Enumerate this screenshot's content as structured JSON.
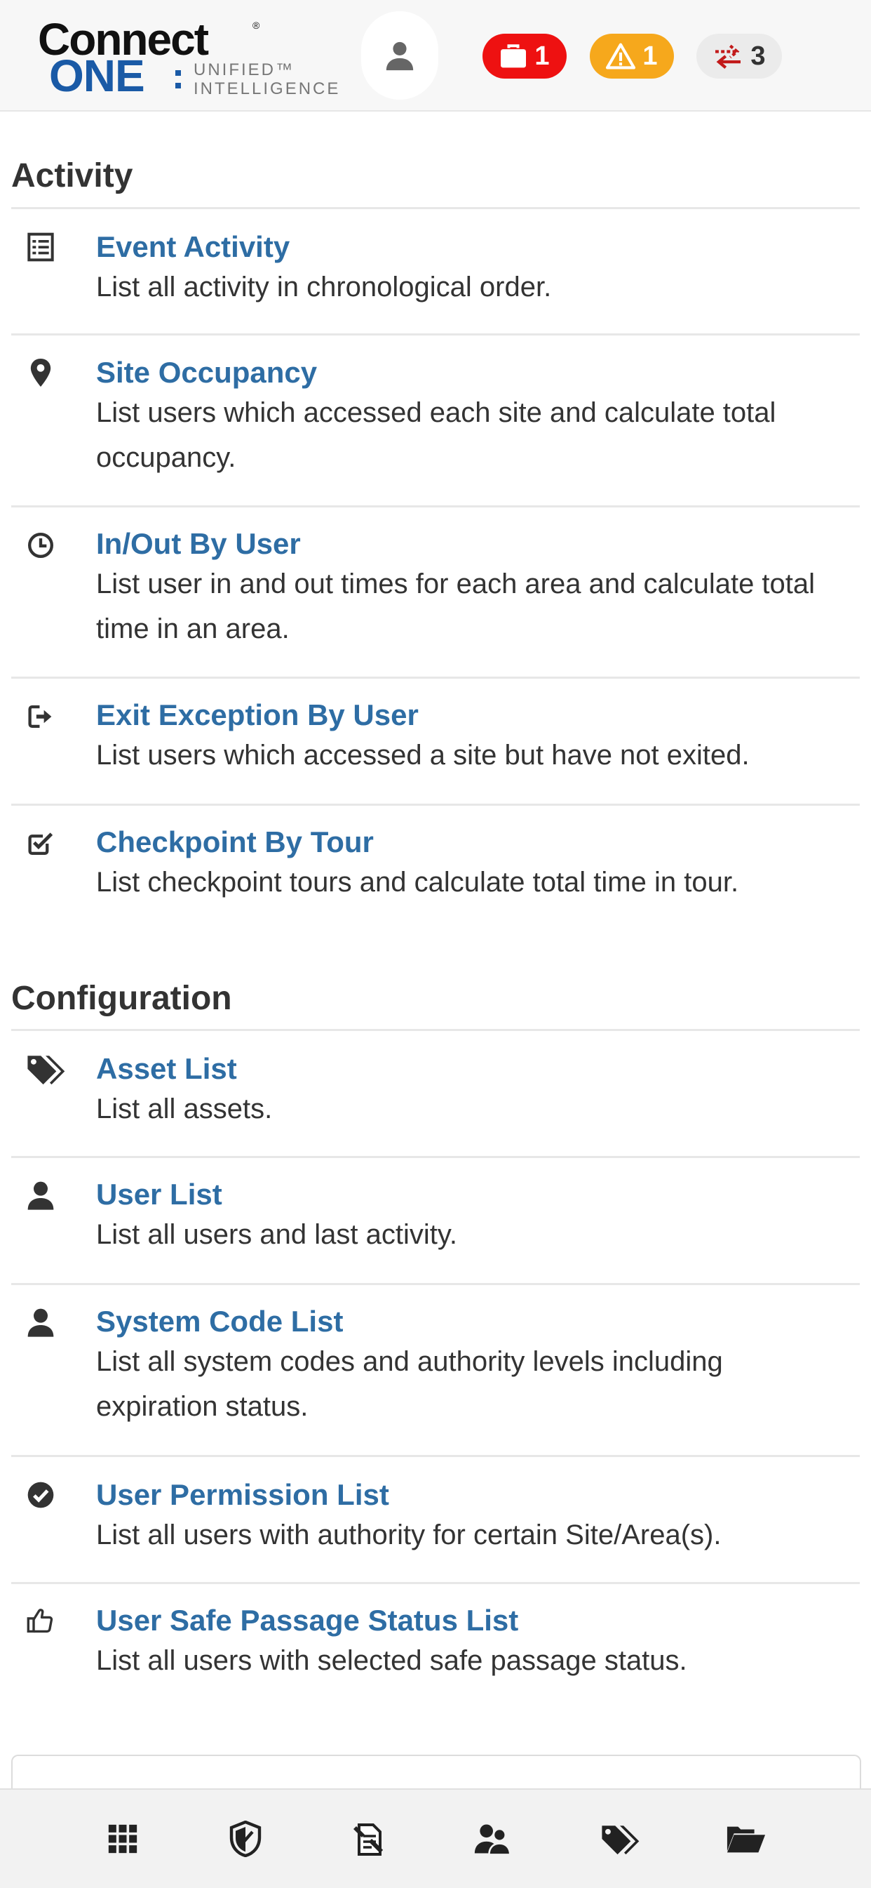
{
  "header": {
    "logo": {
      "word1": "Connect",
      "word2": "ONE",
      "tagline_line1": "UNIFIED™",
      "tagline_line2": "INTELLIGENCE"
    },
    "avatar_icon": "user-icon",
    "badges": [
      {
        "icon": "briefcase-icon",
        "count": "1",
        "color": "#ee1111"
      },
      {
        "icon": "warning-icon",
        "count": "1",
        "color": "#f6a81c"
      },
      {
        "icon": "transfer-arrows-icon",
        "count": "3",
        "color": "#ebebeb"
      }
    ]
  },
  "activity": {
    "title": "Activity",
    "items": [
      {
        "icon": "list-icon",
        "title": "Event Activity",
        "description": "List all activity in chronological order."
      },
      {
        "icon": "map-marker-icon",
        "title": "Site Occupancy",
        "description": "List users which accessed each site and calculate total occupancy."
      },
      {
        "icon": "clock-icon",
        "title": "In/Out By User",
        "description": "List user in and out times for each area and calculate total time in an area."
      },
      {
        "icon": "exit-icon",
        "title": "Exit Exception By User",
        "description": "List users which accessed a site but have not exited."
      },
      {
        "icon": "checkbox-icon",
        "title": "Checkpoint By Tour",
        "description": "List checkpoint tours and calculate total time in tour."
      }
    ]
  },
  "configuration": {
    "title": "Configuration",
    "items": [
      {
        "icon": "tags-icon",
        "title": "Asset List",
        "description": "List all assets."
      },
      {
        "icon": "user-icon",
        "title": "User List",
        "description": "List all users and last activity."
      },
      {
        "icon": "user-icon",
        "title": "System Code List",
        "description": "List all system codes and authority levels including expiration status."
      },
      {
        "icon": "check-circle-icon",
        "title": "User Permission List",
        "description": "List all users with authority for certain Site/Area(s)."
      },
      {
        "icon": "thumbs-up-icon",
        "title": "User Safe Passage Status List",
        "description": "List all users with selected safe passage status."
      }
    ]
  },
  "bottom_nav": [
    {
      "icon": "grid-icon"
    },
    {
      "icon": "shield-icon"
    },
    {
      "icon": "document-edit-icon"
    },
    {
      "icon": "users-icon"
    },
    {
      "icon": "tags-icon"
    },
    {
      "icon": "folder-open-icon"
    }
  ]
}
